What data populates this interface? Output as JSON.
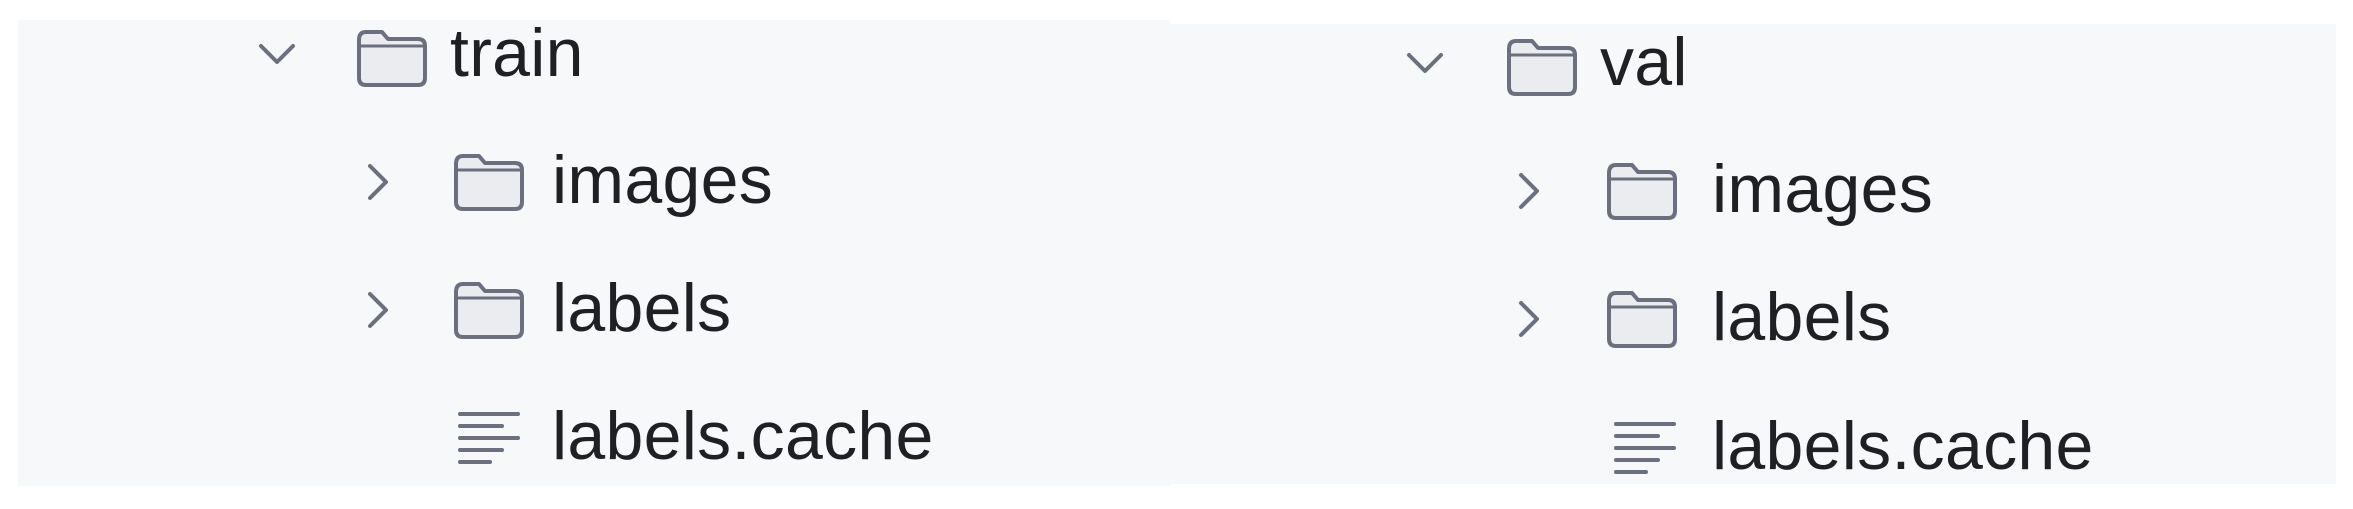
{
  "trees": [
    {
      "root": {
        "label": "train",
        "expanded": true
      },
      "children": [
        {
          "label": "images",
          "type": "folder",
          "expanded": false
        },
        {
          "label": "labels",
          "type": "folder",
          "expanded": false
        },
        {
          "label": "labels.cache",
          "type": "file"
        }
      ]
    },
    {
      "root": {
        "label": "val",
        "expanded": true
      },
      "children": [
        {
          "label": "images",
          "type": "folder",
          "expanded": false
        },
        {
          "label": "labels",
          "type": "folder",
          "expanded": false
        },
        {
          "label": "labels.cache",
          "type": "file"
        }
      ]
    }
  ],
  "icons": {
    "chevron_expanded": "chevron-down-icon",
    "chevron_collapsed": "chevron-right-icon",
    "folder": "folder-icon",
    "file": "text-file-icon"
  },
  "colors": {
    "panel_bg": "#f7f8fa",
    "text": "#1f2023",
    "icon_stroke": "#6c707e",
    "folder_fill": "#ebecf0"
  }
}
